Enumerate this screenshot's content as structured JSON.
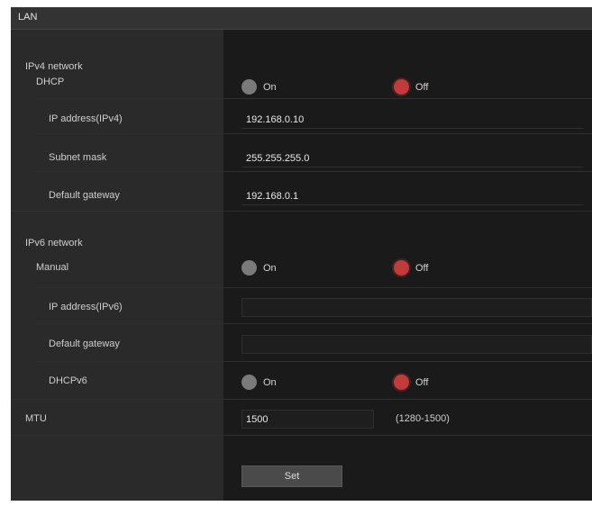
{
  "header": {
    "title": "LAN"
  },
  "ipv4": {
    "section_label": "IPv4 network",
    "dhcp": {
      "label": "DHCP",
      "on_label": "On",
      "off_label": "Off",
      "selected": "Off"
    },
    "ip_address": {
      "label": "IP address(IPv4)",
      "value": "192.168.0.10"
    },
    "subnet_mask": {
      "label": "Subnet mask",
      "value": "255.255.255.0"
    },
    "default_gateway": {
      "label": "Default gateway",
      "value": "192.168.0.1"
    }
  },
  "ipv6": {
    "section_label": "IPv6 network",
    "manual": {
      "label": "Manual",
      "on_label": "On",
      "off_label": "Off",
      "selected": "Off"
    },
    "ip_address": {
      "label": "IP address(IPv6)",
      "value": ""
    },
    "default_gateway": {
      "label": "Default gateway",
      "value": ""
    },
    "dhcpv6": {
      "label": "DHCPv6",
      "on_label": "On",
      "off_label": "Off",
      "selected": "Off"
    }
  },
  "mtu": {
    "label": "MTU",
    "value": "1500",
    "range": "(1280-1500)"
  },
  "actions": {
    "set_label": "Set"
  },
  "colors": {
    "selected_radio": "#c23a3a",
    "unselected_radio": "#7a7a7a",
    "background": "#1a1a1a"
  }
}
